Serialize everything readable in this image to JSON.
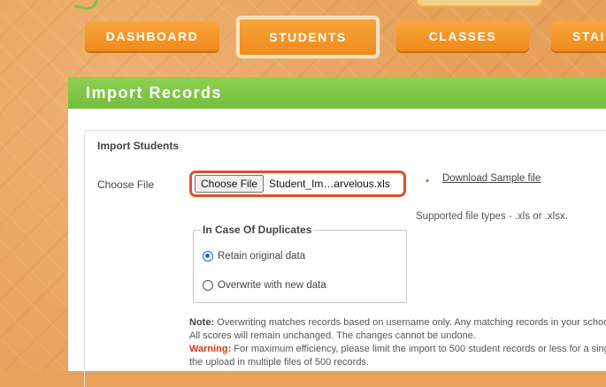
{
  "nav": {
    "tabs": [
      {
        "label": "DASHBOARD"
      },
      {
        "label": "STUDENTS",
        "active": true
      },
      {
        "label": "CLASSES"
      },
      {
        "label": "STAI"
      }
    ]
  },
  "header": {
    "title": "Import Records"
  },
  "panel": {
    "heading": "Import Students",
    "choose_file_label": "Choose File",
    "file_button": "Choose File",
    "file_name": "Student_Im…arvelous.xls",
    "download_link": "Download Sample file",
    "supported_types": "Supported file types - .xls or .xlsx.",
    "duplicates": {
      "legend": "In Case Of Duplicates",
      "options": [
        {
          "label": "Retain original data",
          "selected": true
        },
        {
          "label": "Overwrite with new data",
          "selected": false
        }
      ]
    },
    "note_label": "Note:",
    "note_text": " Overwriting matches records based on username only. Any matching records in your school",
    "note_line2": "All scores will remain unchanged. The changes cannot be undone.",
    "warning_label": "Warning:",
    "warning_text": " For maximum efficiency, please limit the import to 500 student records or less for a single",
    "warning_line2": "the upload in multiple files of 500 records."
  },
  "colors": {
    "tab_orange": "#f39a2c",
    "header_green": "#80c548",
    "focus_ring": "#e0502a",
    "warning_red": "#d8351c",
    "background_orange": "#e6a05a"
  }
}
